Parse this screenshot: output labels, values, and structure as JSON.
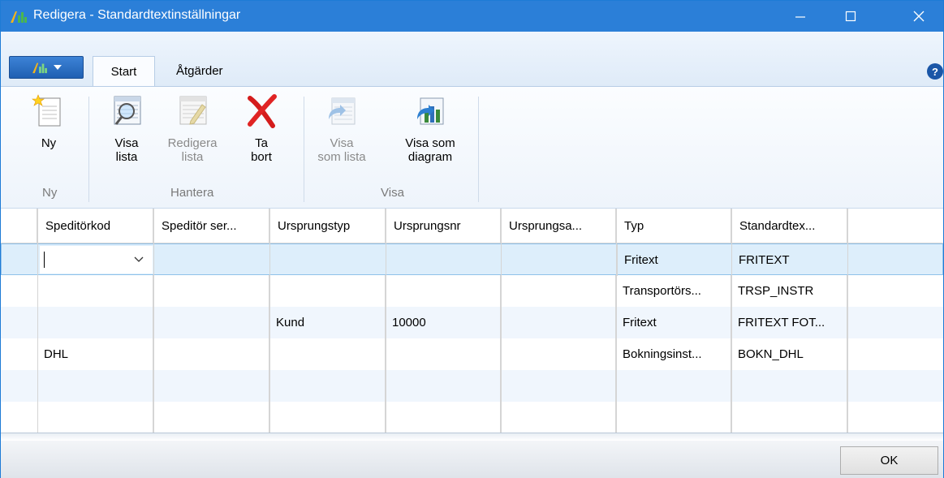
{
  "window": {
    "title": "Redigera - Standardtextinställningar",
    "accent": "#2b7fd8"
  },
  "tabs": {
    "start": "Start",
    "actions": "Åtgärder"
  },
  "ribbon": {
    "new_label_1": "Ny",
    "group_new": "Ny",
    "show_list_1": "Visa",
    "show_list_2": "lista",
    "edit_list_1": "Redigera",
    "edit_list_2": "lista",
    "delete_1": "Ta",
    "delete_2": "bort",
    "group_manage": "Hantera",
    "view_list_1": "Visa",
    "view_list_2": "som lista",
    "view_chart_1": "Visa som",
    "view_chart_2": "diagram",
    "group_view": "Visa"
  },
  "grid": {
    "columns": [
      "Speditörkod",
      "Speditör ser...",
      "Ursprungstyp",
      "Ursprungsnr",
      "Ursprungsa...",
      "Typ",
      "Standardtex..."
    ],
    "rows": [
      [
        "",
        "",
        "",
        "",
        "",
        "Fritext",
        "FRITEXT"
      ],
      [
        "",
        "",
        "",
        "",
        "",
        "Transportörs...",
        "TRSP_INSTR"
      ],
      [
        "",
        "",
        "Kund",
        "10000",
        "",
        "Fritext",
        "FRITEXT FOT..."
      ],
      [
        "DHL",
        "",
        "",
        "",
        "",
        "Bokningsinst...",
        "BOKN_DHL"
      ],
      [
        "",
        "",
        "",
        "",
        "",
        "",
        ""
      ],
      [
        "",
        "",
        "",
        "",
        "",
        "",
        ""
      ]
    ]
  },
  "footer": {
    "ok_label": "OK"
  }
}
